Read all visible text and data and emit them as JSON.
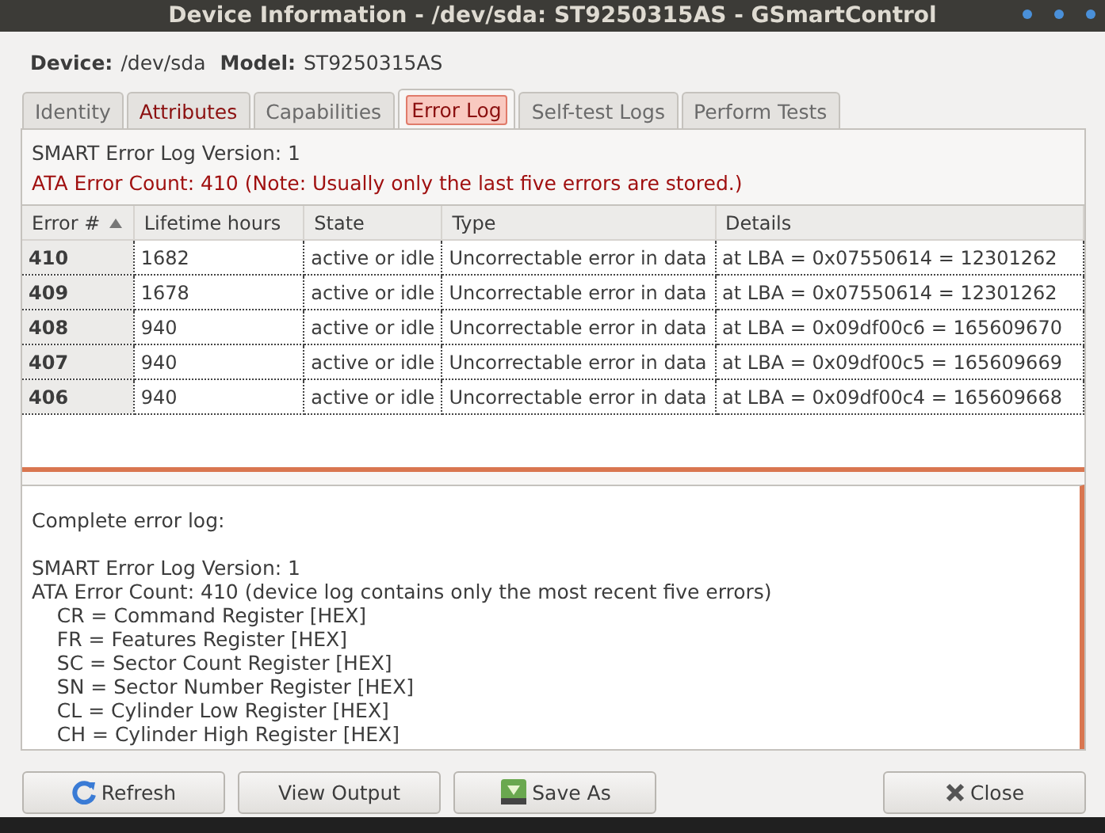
{
  "window": {
    "title": "Device Information - /dev/sda: ST9250315AS - GSmartControl"
  },
  "device": {
    "device_label": "Device:",
    "device_value": "/dev/sda",
    "model_label": "Model:",
    "model_value": "ST9250315AS"
  },
  "tabs": [
    {
      "label": "Identity",
      "selected": false,
      "warning": false
    },
    {
      "label": "Attributes",
      "selected": false,
      "warning": true
    },
    {
      "label": "Capabilities",
      "selected": false,
      "warning": false
    },
    {
      "label": "Error Log",
      "selected": true,
      "warning": true
    },
    {
      "label": "Self-test Logs",
      "selected": false,
      "warning": false
    },
    {
      "label": "Perform Tests",
      "selected": false,
      "warning": false
    }
  ],
  "summary": {
    "version": "SMART Error Log Version: 1",
    "count": "ATA Error Count: 410 (Note: Usually only the last five errors are stored.)"
  },
  "table": {
    "columns": [
      "Error #",
      "Lifetime hours",
      "State",
      "Type",
      "Details"
    ],
    "rows": [
      [
        "410",
        "1682",
        "active or idle",
        "Uncorrectable error in data",
        "at LBA = 0x07550614 = 12301262"
      ],
      [
        "409",
        "1678",
        "active or idle",
        "Uncorrectable error in data",
        "at LBA = 0x07550614 = 12301262"
      ],
      [
        "408",
        "940",
        "active or idle",
        "Uncorrectable error in data",
        "at LBA = 0x09df00c6 = 165609670"
      ],
      [
        "407",
        "940",
        "active or idle",
        "Uncorrectable error in data",
        "at LBA = 0x09df00c5 = 165609669"
      ],
      [
        "406",
        "940",
        "active or idle",
        "Uncorrectable error in data",
        "at LBA = 0x09df00c4 = 165609668"
      ]
    ]
  },
  "log": {
    "heading": "Complete error log:",
    "lines": [
      "SMART Error Log Version: 1",
      "ATA Error Count: 410 (device log contains only the most recent five errors)",
      "\tCR = Command Register [HEX]",
      "\tFR = Features Register [HEX]",
      "\tSC = Sector Count Register [HEX]",
      "\tSN = Sector Number Register [HEX]",
      "\tCL = Cylinder Low Register [HEX]",
      "\tCH = Cylinder High Register [HEX]"
    ]
  },
  "buttons": [
    {
      "label": "Refresh",
      "kind": "refresh"
    },
    {
      "label": "View Output",
      "kind": "plain"
    },
    {
      "label": "Save As",
      "kind": "save"
    },
    {
      "label": "Close",
      "kind": "close"
    }
  ]
}
